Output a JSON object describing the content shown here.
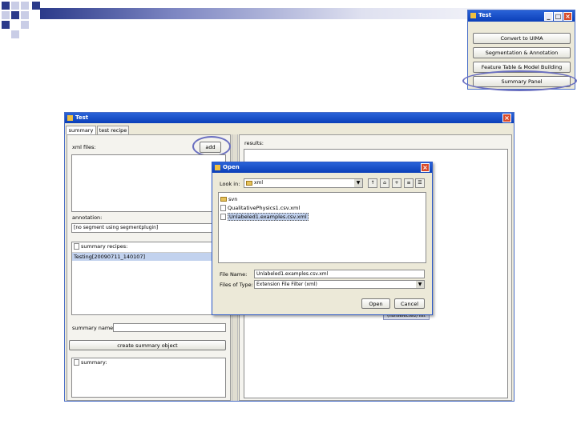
{
  "small_window": {
    "title": "Test",
    "buttons": [
      "Convert to UIMA",
      "Segmentation & Annotation",
      "Feature Table & Model Building",
      "Summary Panel"
    ]
  },
  "main_window": {
    "title": "Test",
    "tabs": [
      "summary",
      "test recipe"
    ],
    "left": {
      "xml_files_label": "xml files:",
      "add_button": "add",
      "annotation_label": "annotation:",
      "annotation_value": "[no segment using segmentplugin]",
      "summary_recipes_label": "summary recipes:",
      "recipe_item": "Testing[20090711_140107]",
      "summary_name_label": "summary name:",
      "create_button": "create summary object",
      "summary_label": "summary:"
    },
    "right": {
      "results_label": "results:",
      "status_text": "(nonselected) list"
    }
  },
  "open_dialog": {
    "title": "Open",
    "look_in_label": "Look in:",
    "look_in_value": "xml",
    "files": [
      {
        "name": "svn",
        "kind": "folder",
        "selected": false
      },
      {
        "name": "QualitativePhysics1.csv.xml",
        "kind": "file",
        "selected": false
      },
      {
        "name": "Unlabeled1.examples.csv.xml",
        "kind": "file",
        "selected": true
      }
    ],
    "file_name_label": "File Name:",
    "file_name_value": "Unlabeled1.examples.csv.xml",
    "files_of_type_label": "Files of Type:",
    "files_of_type_value": "Extension File Filter (xml)",
    "open_button": "Open",
    "cancel_button": "Cancel"
  },
  "colors": {
    "title_blue": "#1c52c8",
    "highlight_ellipse": "#6a6fc0",
    "selection": "#c2d2ee",
    "deco_dark": "#2b3a8a",
    "deco_light": "#c9cde6"
  }
}
